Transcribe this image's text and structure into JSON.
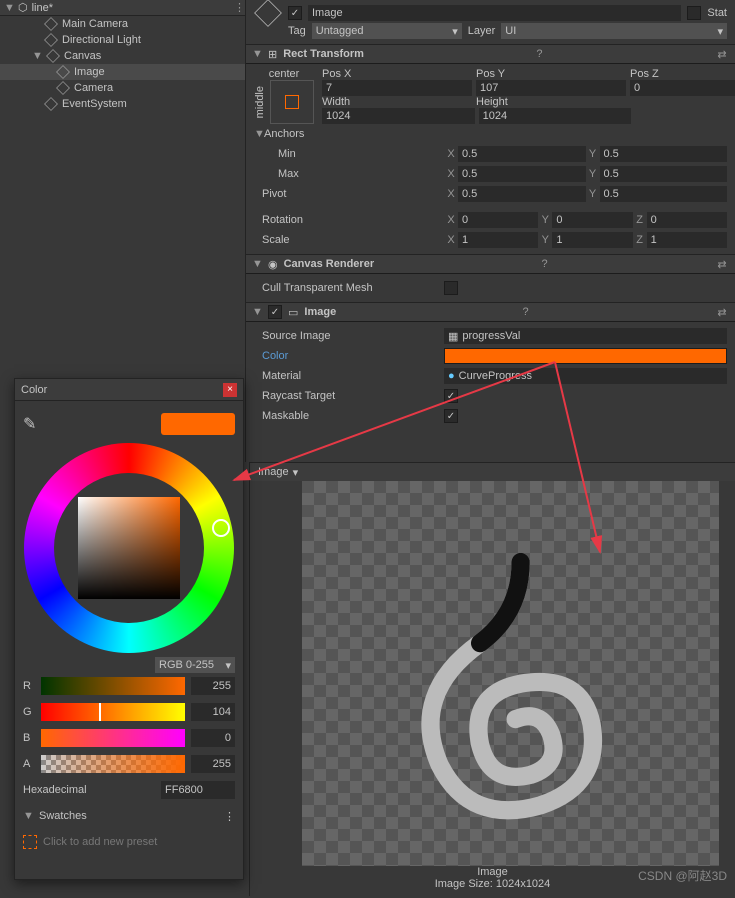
{
  "hierarchy": {
    "scene": "line*",
    "items": [
      "Main Camera",
      "Directional Light",
      "Canvas",
      "Image",
      "Camera",
      "EventSystem"
    ]
  },
  "inspector": {
    "name": "Image",
    "tag_label": "Tag",
    "tag_value": "Untagged",
    "layer_label": "Layer",
    "layer_value": "UI",
    "static_label": "Stat",
    "rect": {
      "title": "Rect Transform",
      "center": "center",
      "middle": "middle",
      "posx_l": "Pos X",
      "posy_l": "Pos Y",
      "posz_l": "Pos Z",
      "posx": "7",
      "posy": "107",
      "posz": "0",
      "width_l": "Width",
      "height_l": "Height",
      "width": "1024",
      "height": "1024",
      "anchors_l": "Anchors",
      "min_l": "Min",
      "max_l": "Max",
      "minx": "0.5",
      "miny": "0.5",
      "maxx": "0.5",
      "maxy": "0.5",
      "pivot_l": "Pivot",
      "pivx": "0.5",
      "pivy": "0.5",
      "rot_l": "Rotation",
      "rotx": "0",
      "roty": "0",
      "rotz": "0",
      "scale_l": "Scale",
      "sclx": "1",
      "scly": "1",
      "sclz": "1",
      "x": "X",
      "y": "Y",
      "z": "Z"
    },
    "canvasr": {
      "title": "Canvas Renderer",
      "cull_l": "Cull Transparent Mesh"
    },
    "image": {
      "title": "Image",
      "src_l": "Source Image",
      "src_v": "progressVal",
      "color_l": "Color",
      "mat_l": "Material",
      "mat_v": "CurveProgress",
      "ray_l": "Raycast Target",
      "mask_l": "Maskable"
    }
  },
  "preview": {
    "tab": "Image",
    "name": "Image",
    "size": "Image Size: 1024x1024"
  },
  "color": {
    "title": "Color",
    "mode": "RGB 0-255",
    "r_l": "R",
    "g_l": "G",
    "b_l": "B",
    "a_l": "A",
    "r": "255",
    "g": "104",
    "b": "0",
    "a": "255",
    "hex_l": "Hexadecimal",
    "hex": "FF6800",
    "swatches_l": "Swatches",
    "preset_l": "Click to add new preset",
    "accent": "#ff6800"
  },
  "watermark": "CSDN @阿赵3D"
}
